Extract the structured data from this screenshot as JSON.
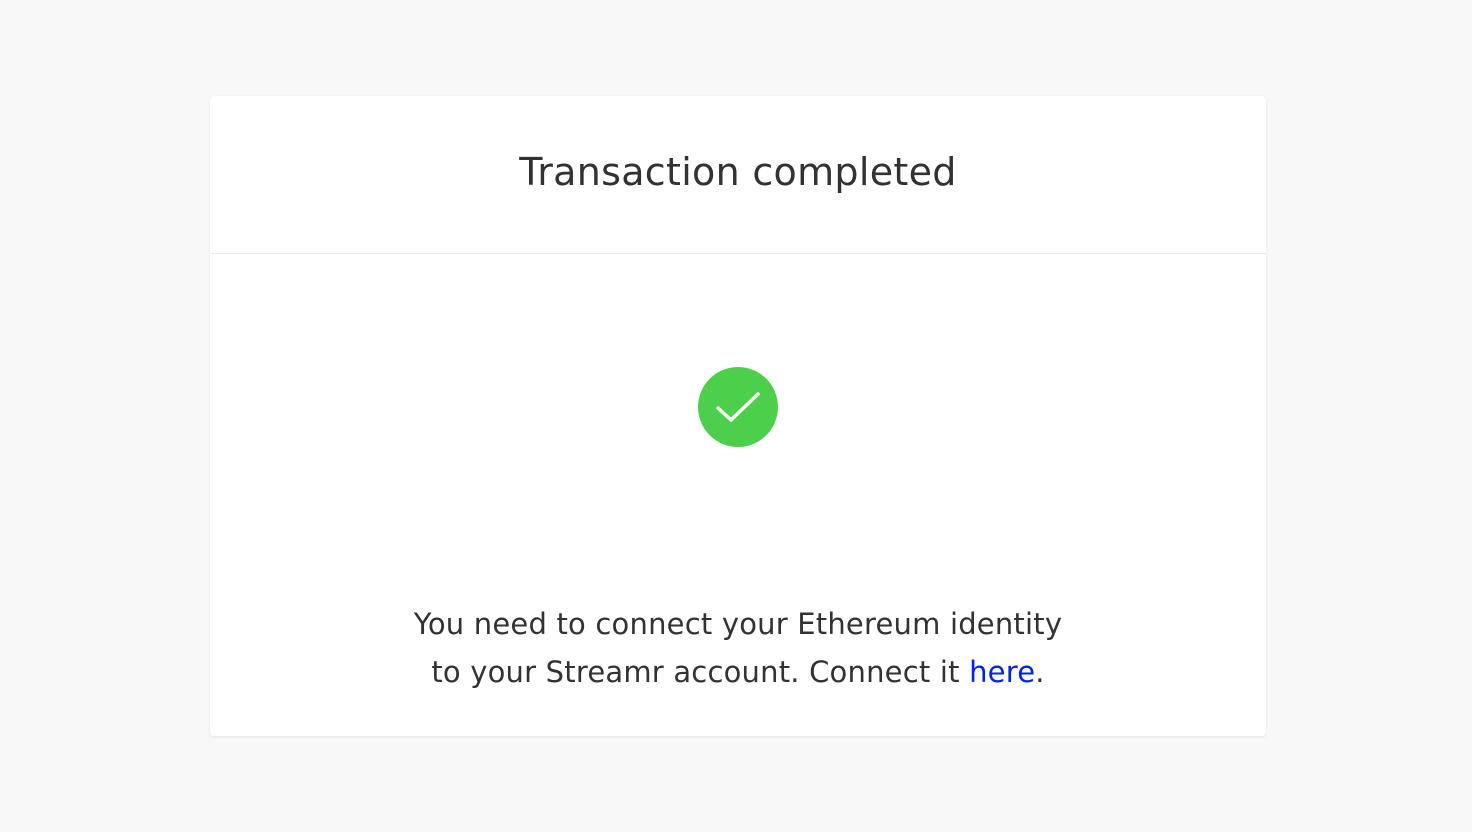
{
  "dialog": {
    "title": "Transaction completed",
    "status_icon": "checkmark-circle-icon",
    "message_line1": "You need to connect your Ethereum identity",
    "message_line2_prefix": "to your Streamr account. Connect it ",
    "link_text": "here",
    "message_line2_suffix": "."
  },
  "colors": {
    "background": "#f8f8f8",
    "card": "#ffffff",
    "success": "#4ccf4a",
    "link": "#0324e6",
    "text": "#323232"
  }
}
